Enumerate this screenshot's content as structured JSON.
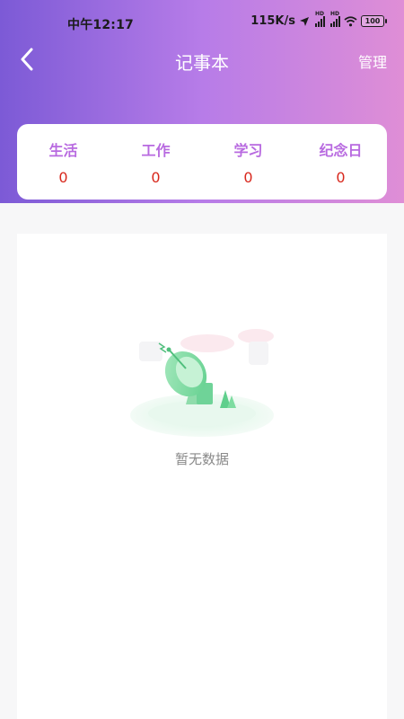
{
  "status_bar": {
    "time": "中午12:17",
    "network_speed": "115K/s",
    "signal1_tag": "HD",
    "signal2_tag": "HD",
    "battery": "100",
    "icons": [
      "location-arrow-icon",
      "signal-icon",
      "signal-icon",
      "wifi-icon",
      "battery-icon"
    ]
  },
  "nav": {
    "back_icon": "chevron-left-icon",
    "title": "记事本",
    "manage_label": "管理"
  },
  "categories": [
    {
      "label": "生活",
      "count": "0"
    },
    {
      "label": "工作",
      "count": "0"
    },
    {
      "label": "学习",
      "count": "0"
    },
    {
      "label": "纪念日",
      "count": "0"
    }
  ],
  "empty_state": {
    "illustration": "satellite-dish-illustration",
    "text": "暂无数据"
  },
  "colors": {
    "header_gradient_start": "#7c5ad6",
    "header_gradient_mid": "#b77ce8",
    "header_gradient_end": "#df8ed6",
    "category_label": "#b86ae0",
    "category_count": "#d8281d"
  }
}
